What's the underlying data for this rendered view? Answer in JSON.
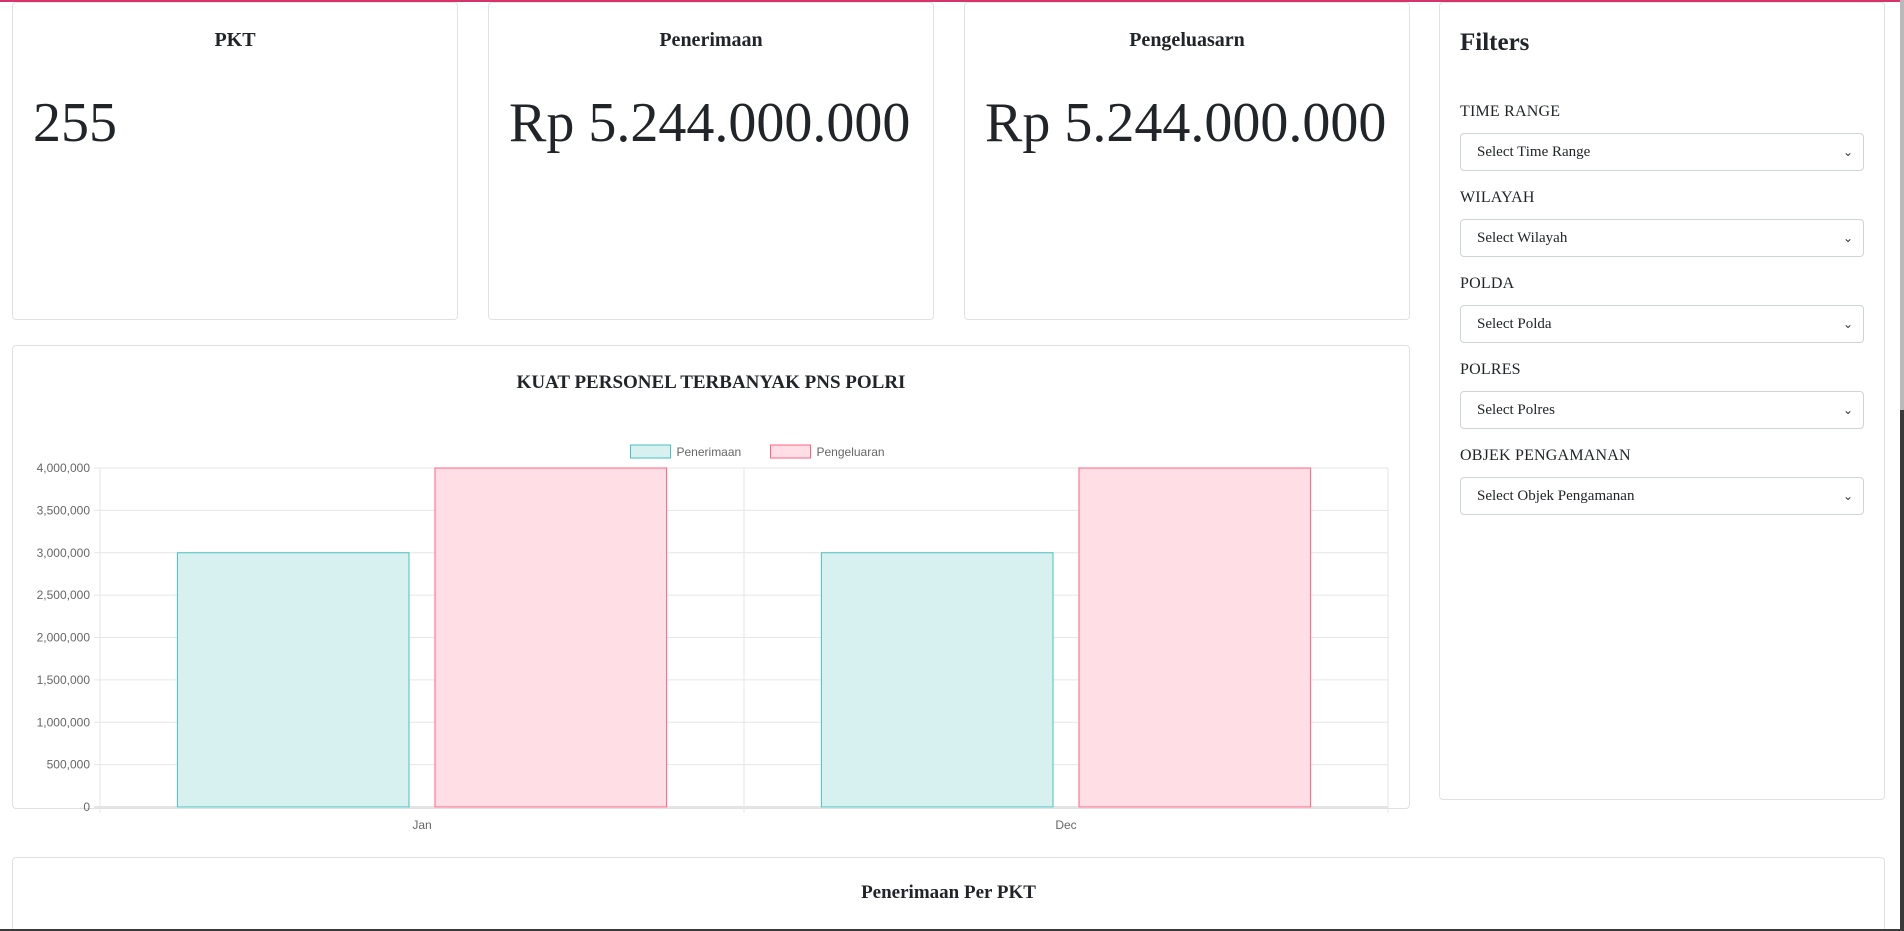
{
  "stats": [
    {
      "title": "PKT",
      "value": "255"
    },
    {
      "title": "Penerimaan",
      "value": "Rp 5.244.000.000"
    },
    {
      "title": "Pengeluasarn",
      "value": "Rp 5.244.000.000"
    }
  ],
  "filters": {
    "title": "Filters",
    "items": [
      {
        "label": "TIME RANGE",
        "placeholder": "Select Time Range"
      },
      {
        "label": "WILAYAH",
        "placeholder": "Select Wilayah"
      },
      {
        "label": "POLDA",
        "placeholder": "Select Polda"
      },
      {
        "label": "POLRES",
        "placeholder": "Select Polres"
      },
      {
        "label": "OBJEK PENGAMANAN",
        "placeholder": "Select Objek Pengamanan"
      }
    ]
  },
  "chart_data": {
    "type": "bar",
    "title": "KUAT PERSONEL TERBANYAK PNS POLRI",
    "categories": [
      "Jan",
      "Dec"
    ],
    "series": [
      {
        "name": "Penerimaan",
        "values": [
          3000000,
          3000000
        ],
        "fill": "#d7f0f0",
        "stroke": "#4bc0c0"
      },
      {
        "name": "Pengeluaran",
        "values": [
          4000000,
          4000000
        ],
        "fill": "#ffdfe5",
        "stroke": "#ff6384"
      }
    ],
    "yticks": [
      "0",
      "500,000",
      "1,000,000",
      "1,500,000",
      "2,000,000",
      "2,500,000",
      "3,000,000",
      "3,500,000",
      "4,000,000"
    ],
    "ylim": [
      0,
      4000000
    ],
    "legend": "top-center",
    "grid": true
  },
  "bottom_section": {
    "title": "Penerimaan Per PKT"
  }
}
